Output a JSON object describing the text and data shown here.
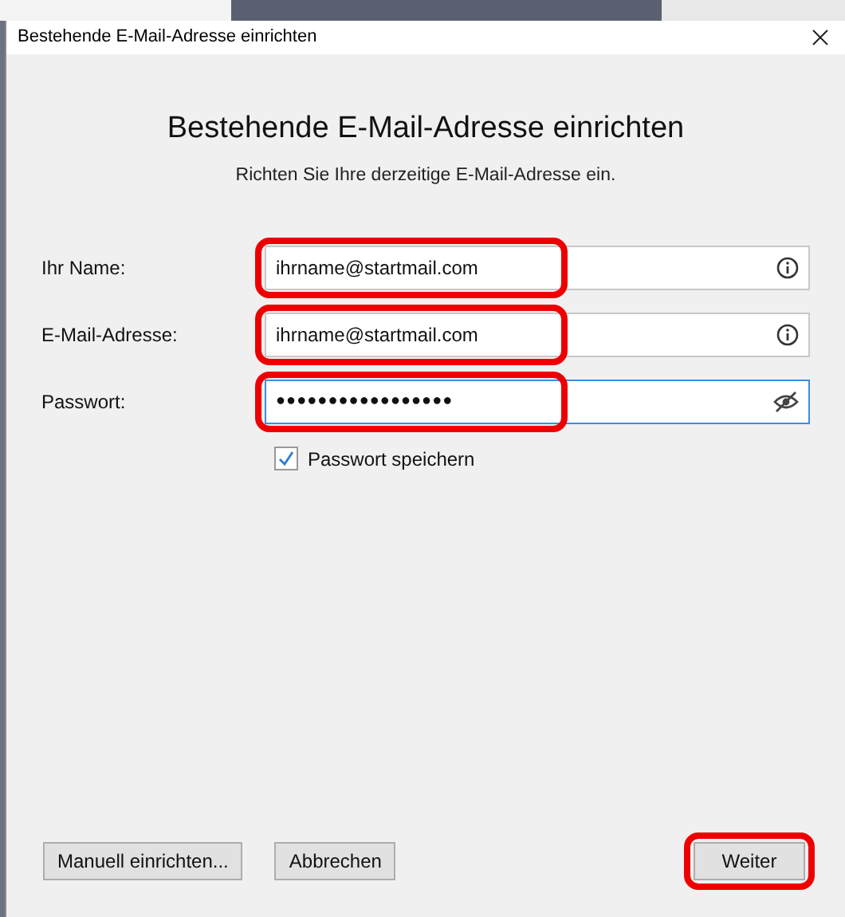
{
  "window": {
    "title": "Bestehende E-Mail-Adresse einrichten"
  },
  "heading": "Bestehende E-Mail-Adresse einrichten",
  "subtitle": "Richten Sie Ihre derzeitige E-Mail-Adresse ein.",
  "fields": [
    {
      "label": "Ihr Name:",
      "value": "ihrname@startmail.com",
      "kind": "info",
      "focused": false,
      "highlighted": true
    },
    {
      "label": "E-Mail-Adresse:",
      "value": "ihrname@startmail.com",
      "kind": "info",
      "focused": false,
      "highlighted": true
    },
    {
      "label": "Passwort:",
      "value": "●●●●●●●●●●●●●●●●●",
      "kind": "password",
      "focused": true,
      "highlighted": true
    }
  ],
  "remember": {
    "label": "Passwort speichern",
    "checked": true
  },
  "buttons": [
    {
      "label": "Manuell einrichten...",
      "highlighted": false
    },
    {
      "label": "Abbrechen",
      "highlighted": false
    },
    {
      "label": "Weiter",
      "highlighted": true
    }
  ]
}
